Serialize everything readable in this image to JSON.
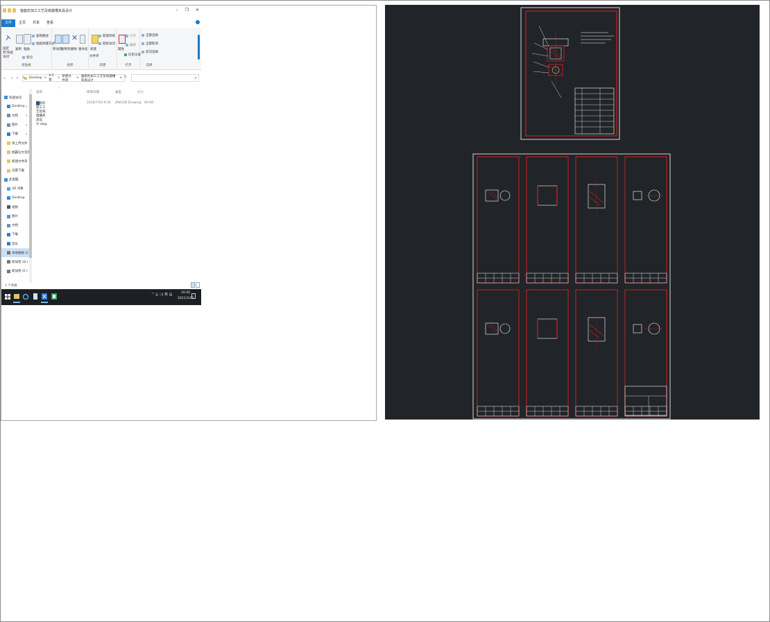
{
  "explorer": {
    "title": "轴套的加工工艺及铣键槽夹具设计",
    "window_buttons": {
      "minimize": "–",
      "maximize": "❐",
      "close": "✕"
    },
    "tabs": [
      {
        "label": "文件"
      },
      {
        "label": "主页"
      },
      {
        "label": "共享"
      },
      {
        "label": "查看"
      }
    ],
    "ribbon": {
      "clipboard": {
        "pin_label": "固定到'快速访问'",
        "copy_label": "复制",
        "paste_label": "粘贴",
        "copy_path": "复制路径",
        "paste_shortcut": "粘贴快捷方式",
        "cut": "剪切",
        "group": "剪贴板"
      },
      "organize": {
        "move_to": "移动到",
        "copy_to": "复制到",
        "delete": "删除",
        "rename": "重命名",
        "group": "组织"
      },
      "new": {
        "new_item": "新建项目",
        "easy_access": "轻松访问",
        "new_folder_line1": "新建",
        "new_folder_line2": "文件夹",
        "group": "新建"
      },
      "open": {
        "properties": "属性",
        "open": "打开",
        "edit": "编辑",
        "history": "历史记录",
        "group": "打开"
      },
      "select": {
        "select_all": "全部选择",
        "select_none": "全部取消",
        "invert": "反向选择",
        "group": "选择"
      }
    },
    "address": {
      "back": "←",
      "forward": "→",
      "recent": "∨",
      "up": "↑",
      "segments": [
        "Desktop",
        ">",
        "X-5套",
        ">",
        "新建文件夹",
        ">",
        "轴套的加工工艺及铣键槽夹具设计"
      ],
      "dropdown": "∨",
      "refresh": "↻",
      "search_icon": "⌕"
    },
    "nav_items": [
      {
        "label": "快速访问",
        "icon_color": "#3b8fe0",
        "pin": false,
        "selected": false
      },
      {
        "label": "Desktop",
        "icon_color": "#2f8ad8",
        "pin": true,
        "selected": false
      },
      {
        "label": "文档",
        "icon_color": "#6d8fb8",
        "pin": true,
        "selected": false
      },
      {
        "label": "图片",
        "icon_color": "#6d8fb8",
        "pin": true,
        "selected": false
      },
      {
        "label": "下载",
        "icon_color": "#2f7dd0",
        "pin": true,
        "selected": false
      },
      {
        "label": "待上传文件",
        "icon_color": "#e6c36a",
        "pin": false,
        "selected": false
      },
      {
        "label": "桃霸论文资料",
        "icon_color": "#e6c36a",
        "pin": false,
        "selected": false
      },
      {
        "label": "新建文件夹",
        "icon_color": "#e6c36a",
        "pin": false,
        "selected": false
      },
      {
        "label": "迅雷下载",
        "icon_color": "#e6c36a",
        "pin": false,
        "selected": false
      },
      {
        "label": "此电脑",
        "icon_color": "#3b8fe0",
        "pin": false,
        "selected": false
      },
      {
        "label": "3D 对象",
        "icon_color": "#5aa7e6",
        "pin": false,
        "selected": false
      },
      {
        "label": "Desktop",
        "icon_color": "#2f8ad8",
        "pin": false,
        "selected": false
      },
      {
        "label": "视频",
        "icon_color": "#555555",
        "pin": false,
        "selected": false
      },
      {
        "label": "图片",
        "icon_color": "#6d8fb8",
        "pin": false,
        "selected": false
      },
      {
        "label": "文档",
        "icon_color": "#6d8fb8",
        "pin": false,
        "selected": false
      },
      {
        "label": "下载",
        "icon_color": "#2f7dd0",
        "pin": false,
        "selected": false
      },
      {
        "label": "音乐",
        "icon_color": "#2f7dd0",
        "pin": false,
        "selected": false
      },
      {
        "label": "本地磁盘 (C:)",
        "icon_color": "#777777",
        "pin": false,
        "selected": true
      },
      {
        "label": "新加卷 (D:)",
        "icon_color": "#777777",
        "pin": false,
        "selected": false
      },
      {
        "label": "新加卷 (E:)",
        "icon_color": "#777777",
        "pin": false,
        "selected": false
      }
    ],
    "columns": [
      "名称",
      "修改日期",
      "类型",
      "大小"
    ],
    "files": [
      {
        "name": "轴套的加工工艺及铣键槽夹具设计.dwg",
        "modified": "2016/7/16 9:34",
        "type": "ZWCAD Drawing",
        "size": "69 KB"
      }
    ],
    "status": "1 个项目",
    "taskbar": {
      "tray": "^ 🖫 ◁) 英 ▤",
      "time": "16:00",
      "date": "2021/3/26"
    }
  },
  "cad": {
    "background": "#212428",
    "border_color": "#ffffff",
    "frame_color": "#e01f1f"
  }
}
